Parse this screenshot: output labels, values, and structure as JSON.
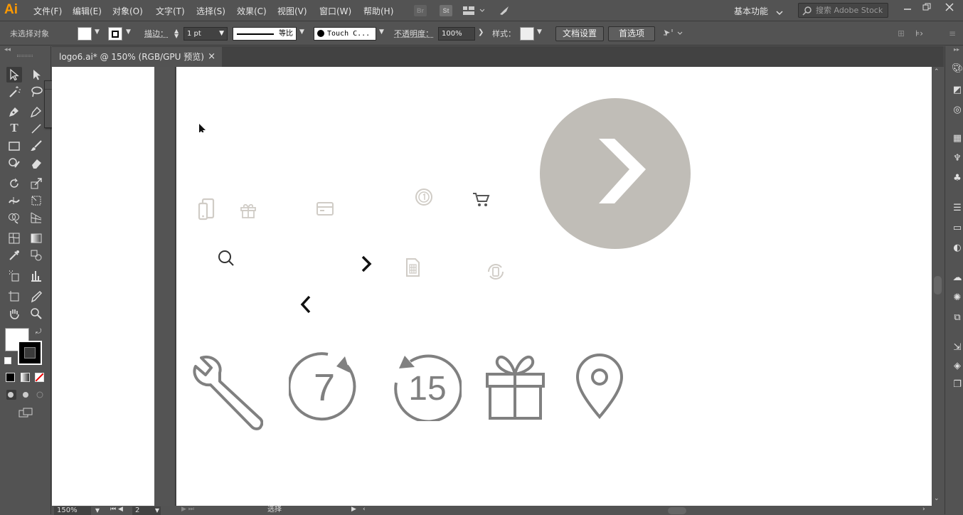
{
  "app": {
    "logo": "Ai"
  },
  "menubar": {
    "items": [
      "文件(F)",
      "编辑(E)",
      "对象(O)",
      "文字(T)",
      "选择(S)",
      "效果(C)",
      "视图(V)",
      "窗口(W)",
      "帮助(H)"
    ],
    "icons": [
      "Br",
      "St"
    ],
    "workspace": "基本功能",
    "search_placeholder": "搜索 Adobe Stock"
  },
  "control_bar": {
    "selection_status": "未选择对象",
    "stroke_label": "描边：",
    "stroke_weight": "1 pt",
    "stroke_profile": "等比",
    "brush": "Touch C...",
    "opacity_label": "不透明度：",
    "opacity_value": "100%",
    "style_label": "样式：",
    "doc_setup_button": "文档设置",
    "preferences_button": "首选项"
  },
  "document": {
    "tab_title": "logo6.ai* @ 150% (RGB/GPU 预览)",
    "close_symbol": "×"
  },
  "status_bar": {
    "zoom": "150%",
    "artboard_number": "2",
    "tool_status": "选择"
  },
  "artwork": {
    "large_icons": [
      "wrench",
      "7",
      "15",
      "gift",
      "location-pin"
    ],
    "colors": {
      "grey_icon": "#808080",
      "light_icon": "#d0ccc6",
      "circle": "#c0bdb7",
      "dark": "#1a1a1a"
    }
  }
}
